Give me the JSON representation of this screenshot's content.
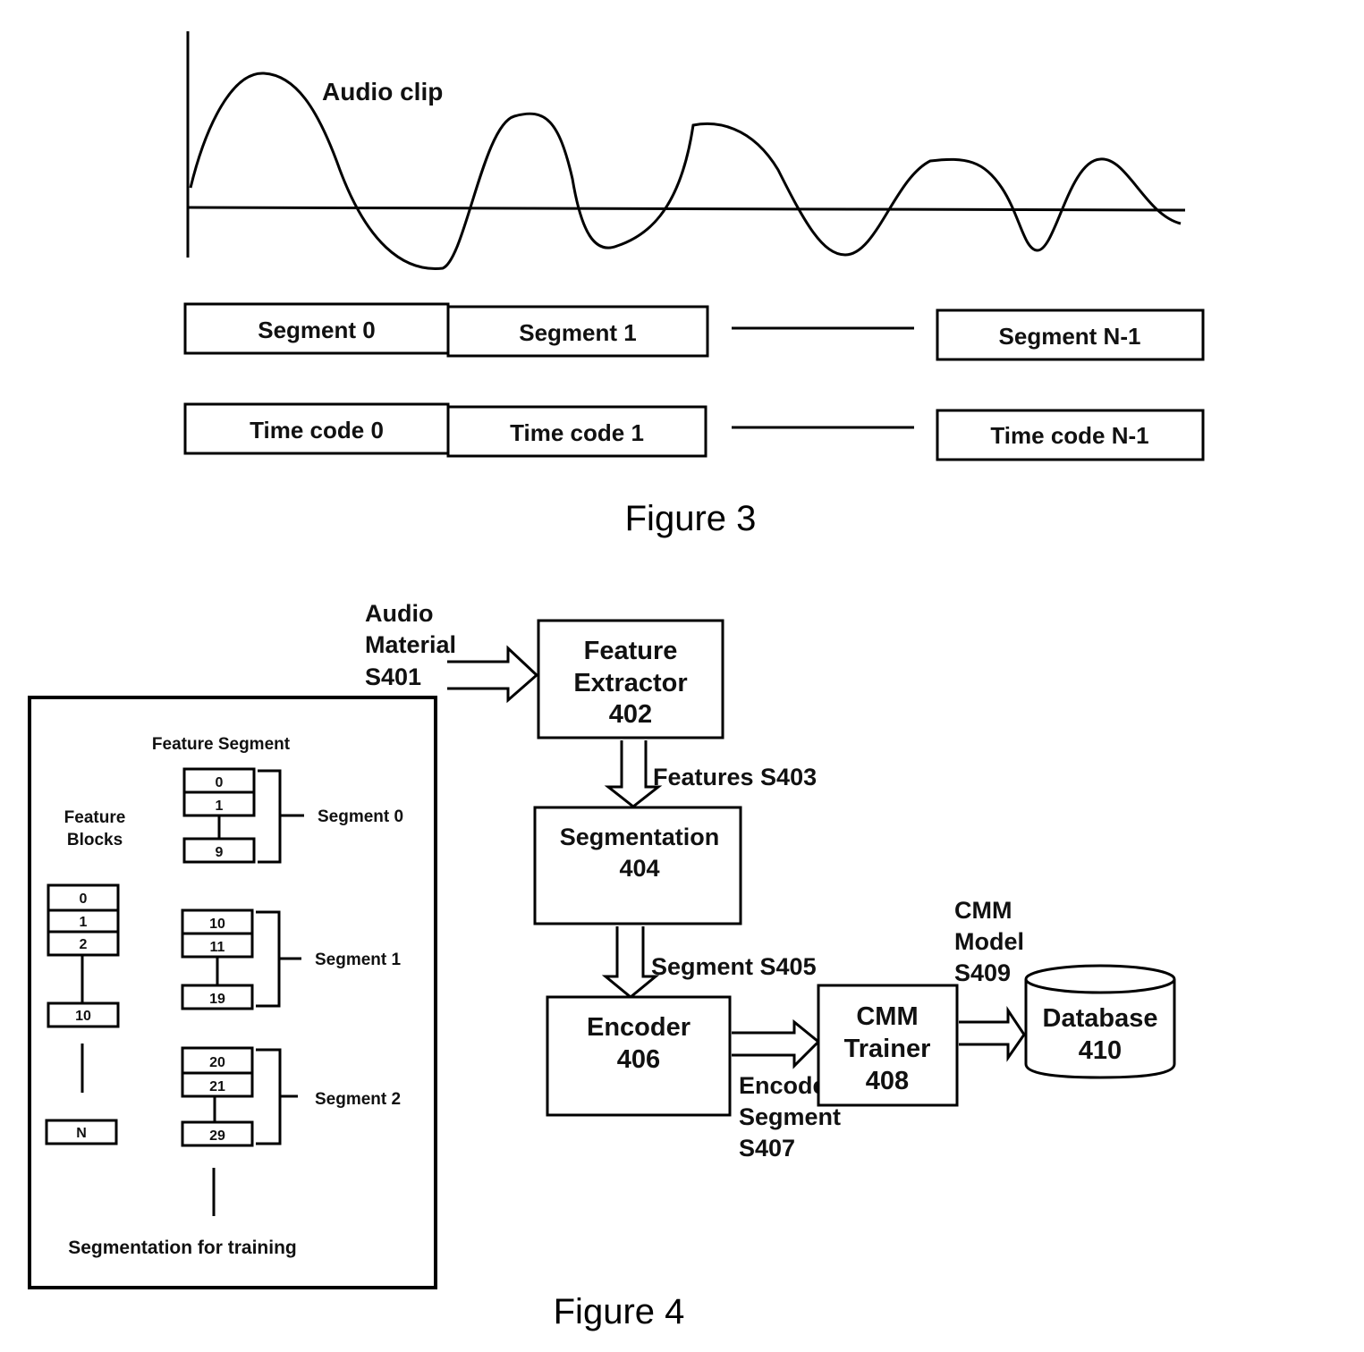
{
  "figure3": {
    "caption": "Figure 3",
    "waveform_label": "Audio clip",
    "segments": [
      "Segment 0",
      "Segment 1",
      "Segment N-1"
    ],
    "time_codes": [
      "Time code 0",
      "Time code 1",
      "Time code N-1"
    ]
  },
  "figure4": {
    "caption": "Figure 4",
    "input_label": [
      "Audio",
      "Material",
      "S401"
    ],
    "feature_extractor": [
      "Feature",
      "Extractor",
      "402"
    ],
    "features_label": "Features S403",
    "segmentation": [
      "Segmentation",
      "404"
    ],
    "segment_label": "Segment S405",
    "encoder": [
      "Encoder",
      "406"
    ],
    "encoded_label": [
      "Encoded",
      "Segment",
      "S407"
    ],
    "cmm_trainer": [
      "CMM",
      "Trainer",
      "408"
    ],
    "cmm_model_label": [
      "CMM",
      "Model",
      "S409"
    ],
    "database": [
      "Database",
      "410"
    ],
    "inset": {
      "feature_segment_title": "Feature Segment",
      "feature_blocks_title": [
        "Feature",
        "Blocks"
      ],
      "blocks": [
        "0",
        "1",
        "2",
        "10",
        "N"
      ],
      "segment_groups": [
        {
          "label": "Segment 0",
          "cells": [
            "0",
            "1",
            "9"
          ]
        },
        {
          "label": "Segment 1",
          "cells": [
            "10",
            "11",
            "19"
          ]
        },
        {
          "label": "Segment 2",
          "cells": [
            "20",
            "21",
            "29"
          ]
        }
      ],
      "footer": "Segmentation for training"
    }
  }
}
